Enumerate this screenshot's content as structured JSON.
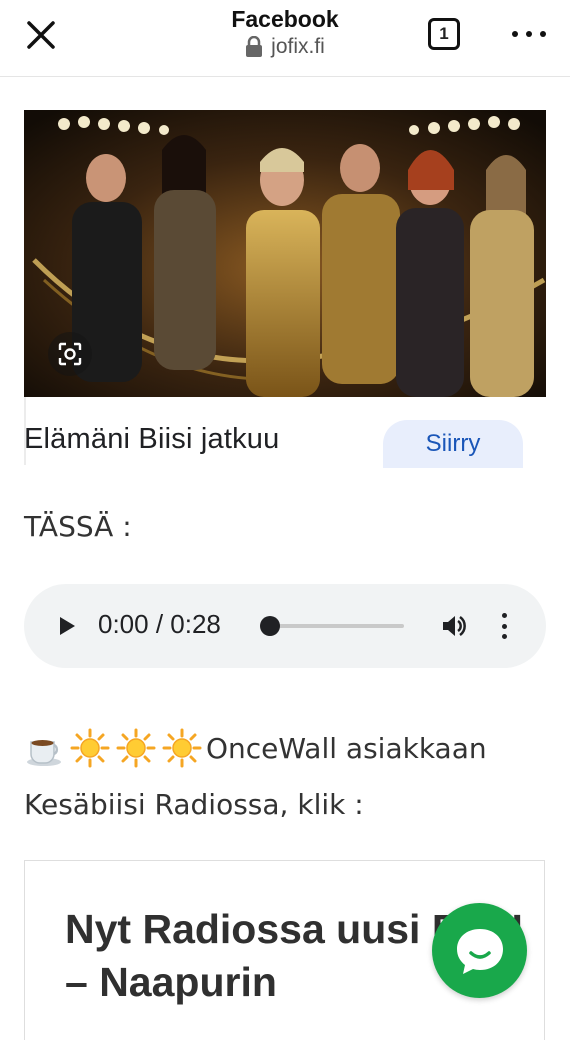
{
  "browser": {
    "title": "Facebook",
    "url": "jofix.fi",
    "tab_count": "1",
    "icons": [
      "close-icon",
      "lock-icon",
      "tabs-icon",
      "more-icon"
    ]
  },
  "ad": {
    "title": "Elämäni Biisi jatkuu",
    "cta_label": "Siirry",
    "icons": [
      "lens-icon"
    ]
  },
  "intro_text": "TÄSSÄ :",
  "audio": {
    "time": "0:00 / 0:28",
    "progress": 0.0,
    "icons": [
      "play-icon",
      "volume-icon",
      "more-vertical-icon"
    ]
  },
  "promo": {
    "emojis": [
      "hot-beverage-emoji",
      "sun-emoji",
      "sun-emoji",
      "sun-emoji"
    ],
    "line1": "OnceWall asiakkaan",
    "line2": "Kesäbiisi Radiossa, klik :"
  },
  "article": {
    "title": "Nyt Radiossa uusi BIISI – Naapurin"
  },
  "chat": {
    "icon": "chat-icon"
  },
  "colors": {
    "cta_bg": "#e8eefc",
    "cta_text": "#1a56b8",
    "chat_fab": "#19a84b",
    "audio_bg": "#f1f3f4"
  }
}
